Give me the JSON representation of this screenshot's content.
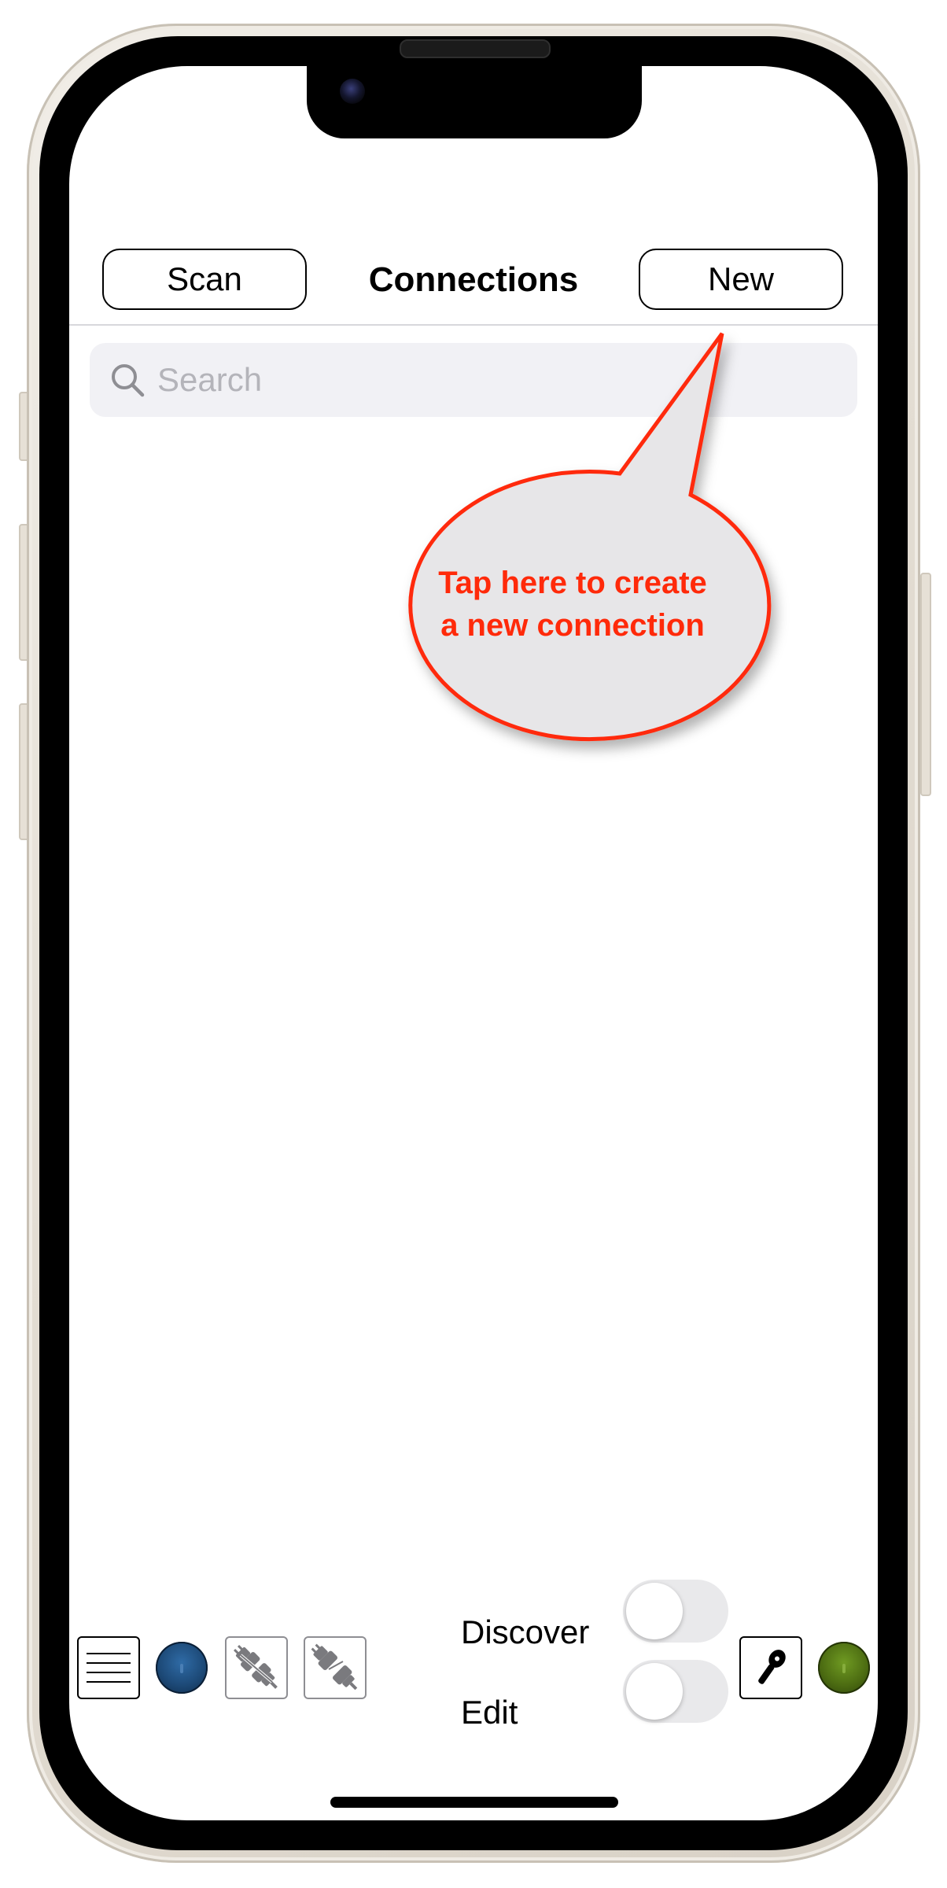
{
  "nav": {
    "scan_label": "Scan",
    "title": "Connections",
    "new_label": "New"
  },
  "search": {
    "placeholder": "Search"
  },
  "callout": {
    "line1": "Tap here to create",
    "line2": "a new connection",
    "text_color": "#ff2a0a",
    "fill_color": "#e7e6e8"
  },
  "toolbar": {
    "discover_label": "Discover",
    "edit_label": "Edit",
    "discover_on": false,
    "edit_on": false,
    "blue_indicator_color": "#1d4a78",
    "green_indicator_color": "#4d6d12",
    "icons": [
      "menu-icon",
      "blue-status-indicator",
      "plug-connect-icon",
      "plug-disconnect-icon",
      "microphone-icon",
      "green-status-indicator"
    ]
  }
}
